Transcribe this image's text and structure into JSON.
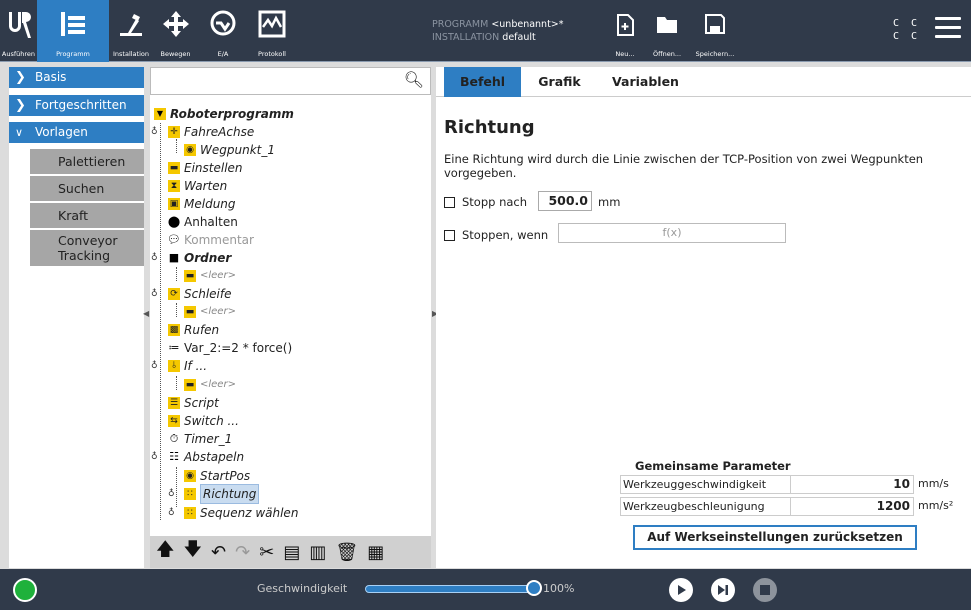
{
  "topbar": {
    "buttons": [
      {
        "label": "Ausführen",
        "icon": "ur-logo-icon"
      },
      {
        "label": "Programm",
        "icon": "program-tree-icon"
      },
      {
        "label": "Installation",
        "icon": "installation-icon"
      },
      {
        "label": "Bewegen",
        "icon": "move-arrows-icon"
      },
      {
        "label": "E/A",
        "icon": "io-icon"
      },
      {
        "label": "Protokoll",
        "icon": "log-icon"
      }
    ],
    "program_key": "PROGRAMM",
    "program_value": "<unbenannt>*",
    "installation_key": "INSTALLATION",
    "installation_value": "default",
    "file_buttons": [
      {
        "label": "Neu...",
        "icon": "new-file-icon"
      },
      {
        "label": "Öffnen...",
        "icon": "folder-icon"
      },
      {
        "label": "Speichern...",
        "icon": "save-icon"
      }
    ],
    "cc_line1": "C C",
    "cc_line2": "C C"
  },
  "leftnav": {
    "items": [
      {
        "label": "Basis"
      },
      {
        "label": "Fortgeschritten"
      },
      {
        "label": "Vorlagen"
      }
    ],
    "subitems": [
      "Palettieren",
      "Suchen",
      "Kraft",
      "Conveyor Tracking"
    ]
  },
  "tree": {
    "search_value": "",
    "root": "Roboterprogramm",
    "nodes": [
      "FahreAchse",
      "Wegpunkt_1",
      "Einstellen",
      "Warten",
      "Meldung",
      "Anhalten",
      "Kommentar",
      "Ordner",
      "<leer>",
      "Schleife",
      "<leer>",
      "Rufen",
      "Var_2:=2 * force()",
      "If ...",
      "<leer>",
      "Script",
      "Switch ...",
      "Timer_1",
      "Abstapeln",
      "StartPos",
      "Richtung",
      "Sequenz wählen"
    ]
  },
  "tabs": [
    "Befehl",
    "Grafik",
    "Variablen"
  ],
  "main": {
    "title": "Richtung",
    "description": "Eine Richtung wird durch die Linie zwischen der TCP-Position von zwei Wegpunkten vorgegeben.",
    "stop_after_label": "Stopp nach",
    "stop_after_value": "500.0",
    "stop_after_unit": "mm",
    "stop_when_label": "Stoppen, wenn",
    "stop_when_placeholder": "f(x)",
    "params_title": "Gemeinsame Parameter",
    "params": [
      {
        "label": "Werkzeuggeschwindigkeit",
        "value": "10",
        "unit": "mm/s"
      },
      {
        "label": "Werkzeugbeschleunigung",
        "value": "1200",
        "unit": "mm/s²"
      }
    ],
    "reset_label": "Auf Werkseinstellungen zurücksetzen"
  },
  "bottombar": {
    "speed_label": "Geschwindigkeit",
    "speed_value": "100%",
    "speed_fraction": 1.0
  },
  "colors": {
    "accent": "#2e7ec3",
    "topbar": "#303a4a",
    "power": "#1fb13b"
  }
}
